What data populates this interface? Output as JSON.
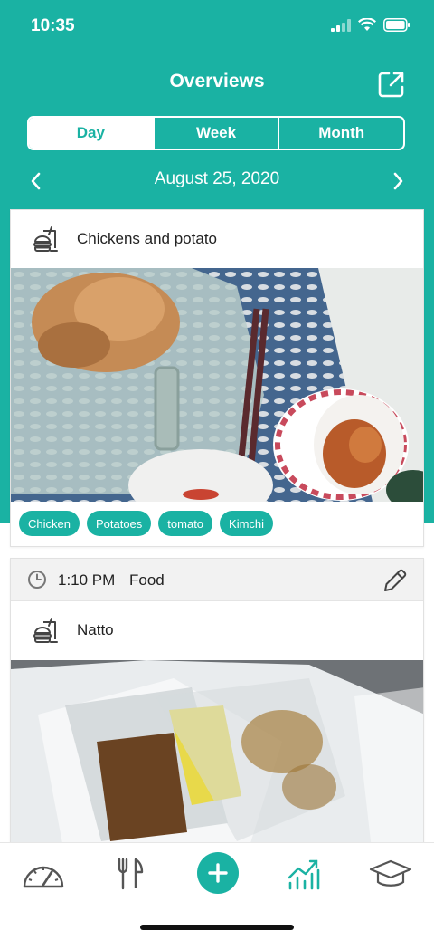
{
  "status_bar": {
    "time": "10:35"
  },
  "header": {
    "title": "Overviews",
    "export_icon": "export-icon"
  },
  "segments": [
    {
      "label": "Day",
      "active": true
    },
    {
      "label": "Week",
      "active": false
    },
    {
      "label": "Month",
      "active": false
    }
  ],
  "date_nav": {
    "date": "August 25, 2020",
    "prev_icon": "chevron-left-icon",
    "next_icon": "chevron-right-icon"
  },
  "entries": [
    {
      "title": "Chickens and potato",
      "meal_icon": "meal-icon",
      "photo": "roast chicken, chopsticks and kimchi",
      "tags": [
        "Chicken",
        "Potatoes",
        "tomato",
        "Kimchi"
      ]
    },
    {
      "time": "1:10 PM",
      "type": "Food",
      "title": "Natto",
      "meal_icon": "meal-icon",
      "photo": "natto packets in container"
    }
  ],
  "tab_bar": {
    "items": [
      "dashboard-icon",
      "fork-knife-icon",
      "add-icon",
      "chart-icon",
      "graduation-cap-icon"
    ],
    "active": "chart-icon"
  },
  "colors": {
    "accent": "#1ab2a3",
    "text": "#222222",
    "icon": "#555555"
  }
}
